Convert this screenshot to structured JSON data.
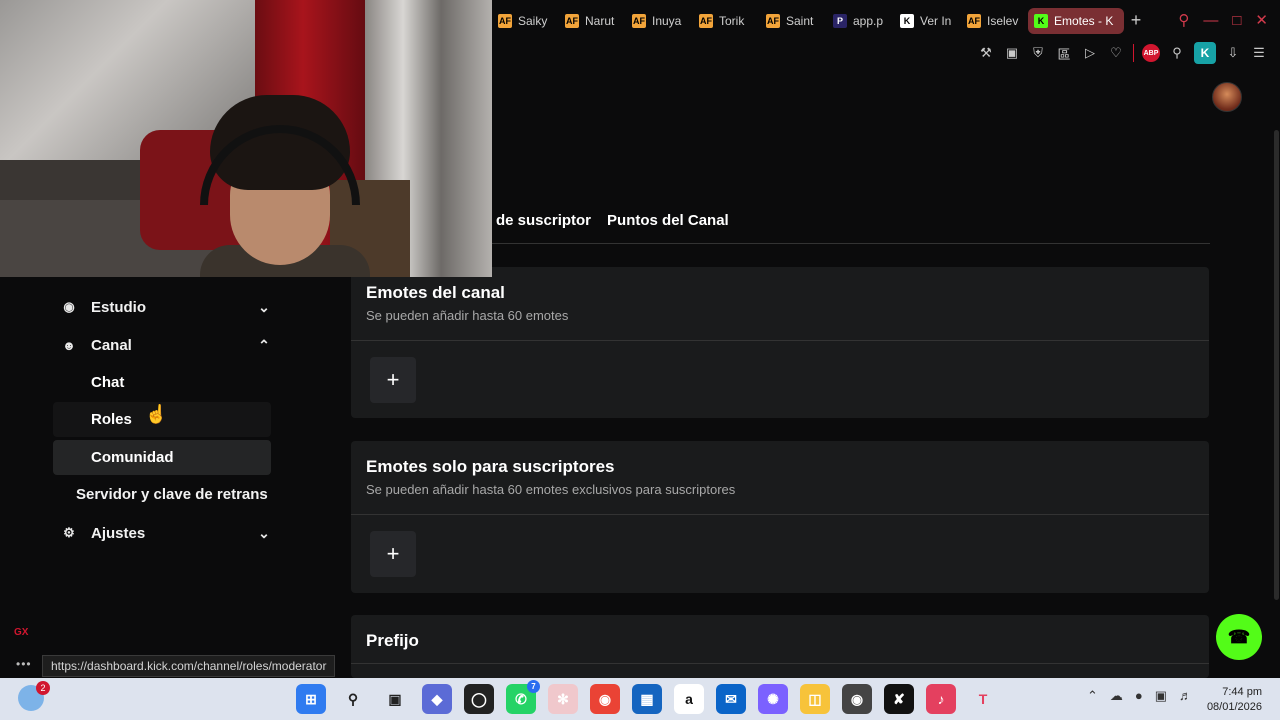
{
  "browser": {
    "tabs": [
      {
        "label": "Saiky",
        "favicon": "AF",
        "kind": "af"
      },
      {
        "label": "Narut",
        "favicon": "AF",
        "kind": "af"
      },
      {
        "label": "Inuya",
        "favicon": "AF",
        "kind": "af"
      },
      {
        "label": "Torik",
        "favicon": "AF",
        "kind": "af"
      },
      {
        "label": "Saint",
        "favicon": "AF",
        "kind": "af"
      },
      {
        "label": "app.p",
        "favicon": "P",
        "kind": "p"
      },
      {
        "label": "Ver In",
        "favicon": "K",
        "kind": "k"
      },
      {
        "label": "Iselev",
        "favicon": "AF",
        "kind": "af"
      },
      {
        "label": "Emotes - K",
        "favicon": "K",
        "kind": "kick",
        "active": true
      }
    ],
    "new_tab_icon": "plus-icon",
    "toolbar_icons": [
      "pin-icon",
      "snapshot-icon",
      "shield-icon",
      "translate-icon",
      "play-icon",
      "heart-icon",
      "adblock-icon",
      "extensions-icon",
      "kick-extension-icon",
      "download-icon",
      "menu-icon"
    ],
    "adblock_label": "ABP",
    "kick_extension_label": "K",
    "status_url": "https://dashboard.kick.com/channel/roles/moderator"
  },
  "content_tabs": {
    "partial": "de suscriptor",
    "points": "Puntos del Canal"
  },
  "sidebar": {
    "studio": "Estudio",
    "channel": "Canal",
    "chat": "Chat",
    "roles": "Roles",
    "community": "Comunidad",
    "server": "Servidor y clave de retrans",
    "settings": "Ajustes",
    "gx_label": "GX",
    "more_label": "•••"
  },
  "cards": {
    "channel_emotes": {
      "title": "Emotes del canal",
      "desc": "Se pueden añadir hasta 60 emotes",
      "add": "+"
    },
    "sub_emotes": {
      "title": "Emotes solo para suscriptores",
      "desc": "Se pueden añadir hasta 60 emotes exclusivos para suscriptores",
      "add": "+"
    },
    "prefix": {
      "title": "Prefijo"
    }
  },
  "taskbar": {
    "weather_badge": "2",
    "whatsapp_badge": "7",
    "amazon_label": "a",
    "tiktok_label": "♪",
    "time": "7:44 pm",
    "date": "08/01/2026"
  },
  "colors": {
    "accent": "#53fc18",
    "background": "#0b0b0c",
    "card": "#1a1b1c",
    "active_tab": "#7a2f33",
    "opera_red": "#d1162f"
  }
}
